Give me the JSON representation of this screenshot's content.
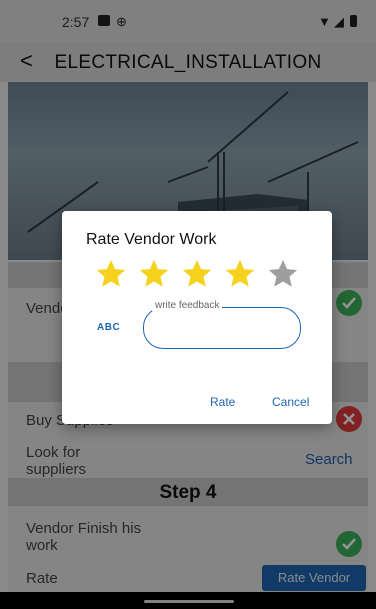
{
  "status_bar": {
    "time": "2:57"
  },
  "app_bar": {
    "back": "<",
    "title": "ELECTRICAL_INSTALLATION"
  },
  "rows": {
    "vendor_label": "Vendor",
    "buy_label": "Buy Supplies",
    "look_for_label": "Look for\nsuppliers",
    "search_link": "Search",
    "step_title": "Step 4",
    "vendor_finish_label": "Vendor Finish his\nwork",
    "rate_label": "Rate",
    "rate_vendor_button": "Rate Vendor"
  },
  "dialog": {
    "title": "Rate Vendor Work",
    "rating": 4,
    "max_rating": 5,
    "input_icon_label": "ABC",
    "input_placeholder": "write feedback",
    "input_value": "",
    "rate_button": "Rate",
    "cancel_button": "Cancel"
  },
  "colors": {
    "accent": "#1e66b0",
    "star_filled": "#f4d21e",
    "star_empty": "#9e9e9e",
    "check_green": "#3bb05a",
    "error_red": "#dc3b3b"
  },
  "icons": {
    "status": [
      "photo-icon",
      "cast-icon",
      "wifi-icon",
      "signal-icon",
      "battery-icon"
    ],
    "row_status": [
      "check-circle-icon",
      "cancel-circle-icon",
      "check-circle-icon"
    ]
  }
}
